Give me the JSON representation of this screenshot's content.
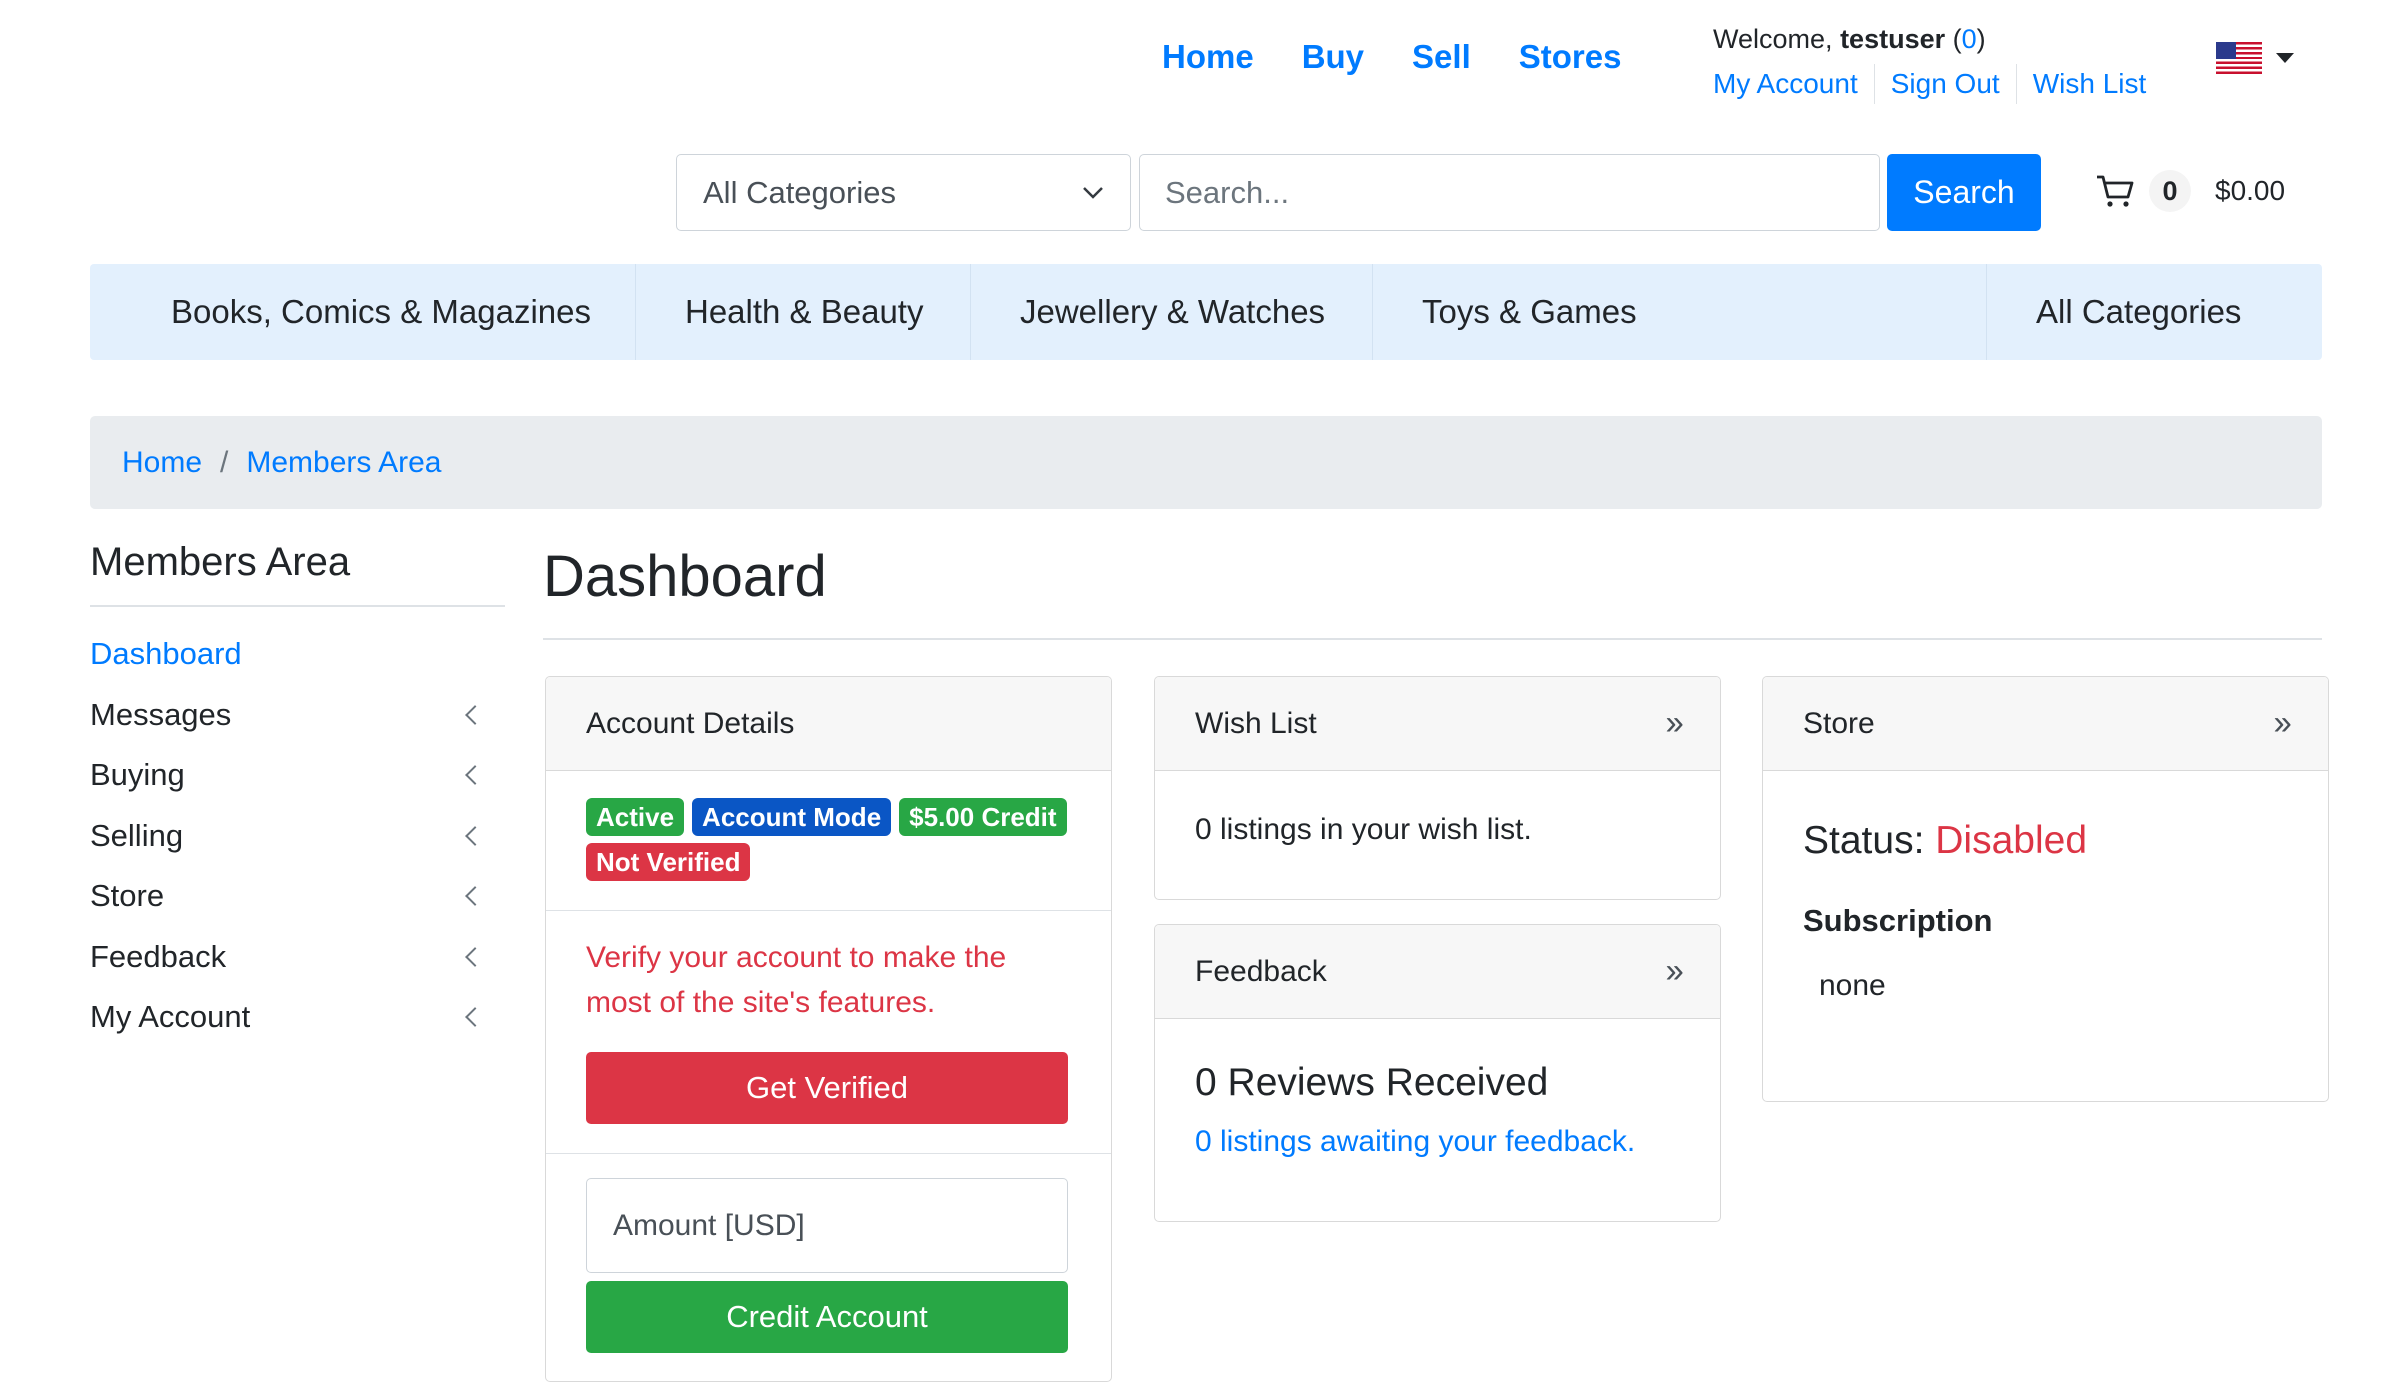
{
  "header": {
    "nav": [
      "Home",
      "Buy",
      "Sell",
      "Stores"
    ],
    "welcome_prefix": "Welcome,",
    "username": "testuser",
    "message_count": "0",
    "links": [
      "My Account",
      "Sign Out",
      "Wish List"
    ]
  },
  "search": {
    "category_value": "All Categories",
    "placeholder": "Search...",
    "button_label": "Search"
  },
  "cart": {
    "count": "0",
    "total": "$0.00"
  },
  "category_nav": {
    "items": [
      "Books, Comics & Magazines",
      "Health & Beauty",
      "Jewellery & Watches",
      "Toys & Games"
    ],
    "all_label": "All Categories"
  },
  "breadcrumb": [
    "Home",
    "Members Area"
  ],
  "sidebar": {
    "title": "Members Area",
    "items": [
      {
        "label": "Dashboard",
        "active": true
      },
      {
        "label": "Messages"
      },
      {
        "label": "Buying"
      },
      {
        "label": "Selling"
      },
      {
        "label": "Store"
      },
      {
        "label": "Feedback"
      },
      {
        "label": "My Account"
      }
    ]
  },
  "main": {
    "title": "Dashboard",
    "account_details": {
      "title": "Account Details",
      "badges": [
        "Active",
        "Account Mode",
        "$5.00 Credit",
        "Not Verified"
      ],
      "verify_message": "Verify your account to make the most of the site's features.",
      "verify_button": "Get Verified",
      "amount_placeholder": "Amount [USD]",
      "credit_button": "Credit Account"
    },
    "wish_list": {
      "title": "Wish List",
      "text": "0 listings in your wish list."
    },
    "feedback": {
      "title": "Feedback",
      "reviews": "0 Reviews Received",
      "awaiting": "0 listings awaiting your feedback."
    },
    "store": {
      "title": "Store",
      "status_label": "Status:",
      "status_value": "Disabled",
      "subscription_label": "Subscription",
      "subscription_value": "none"
    }
  },
  "colors": {
    "link": "#007bff",
    "danger": "#dc3545",
    "success": "#28a745",
    "nav_bg": "#e3f0fd",
    "breadcrumb_bg": "#e9ecef"
  }
}
